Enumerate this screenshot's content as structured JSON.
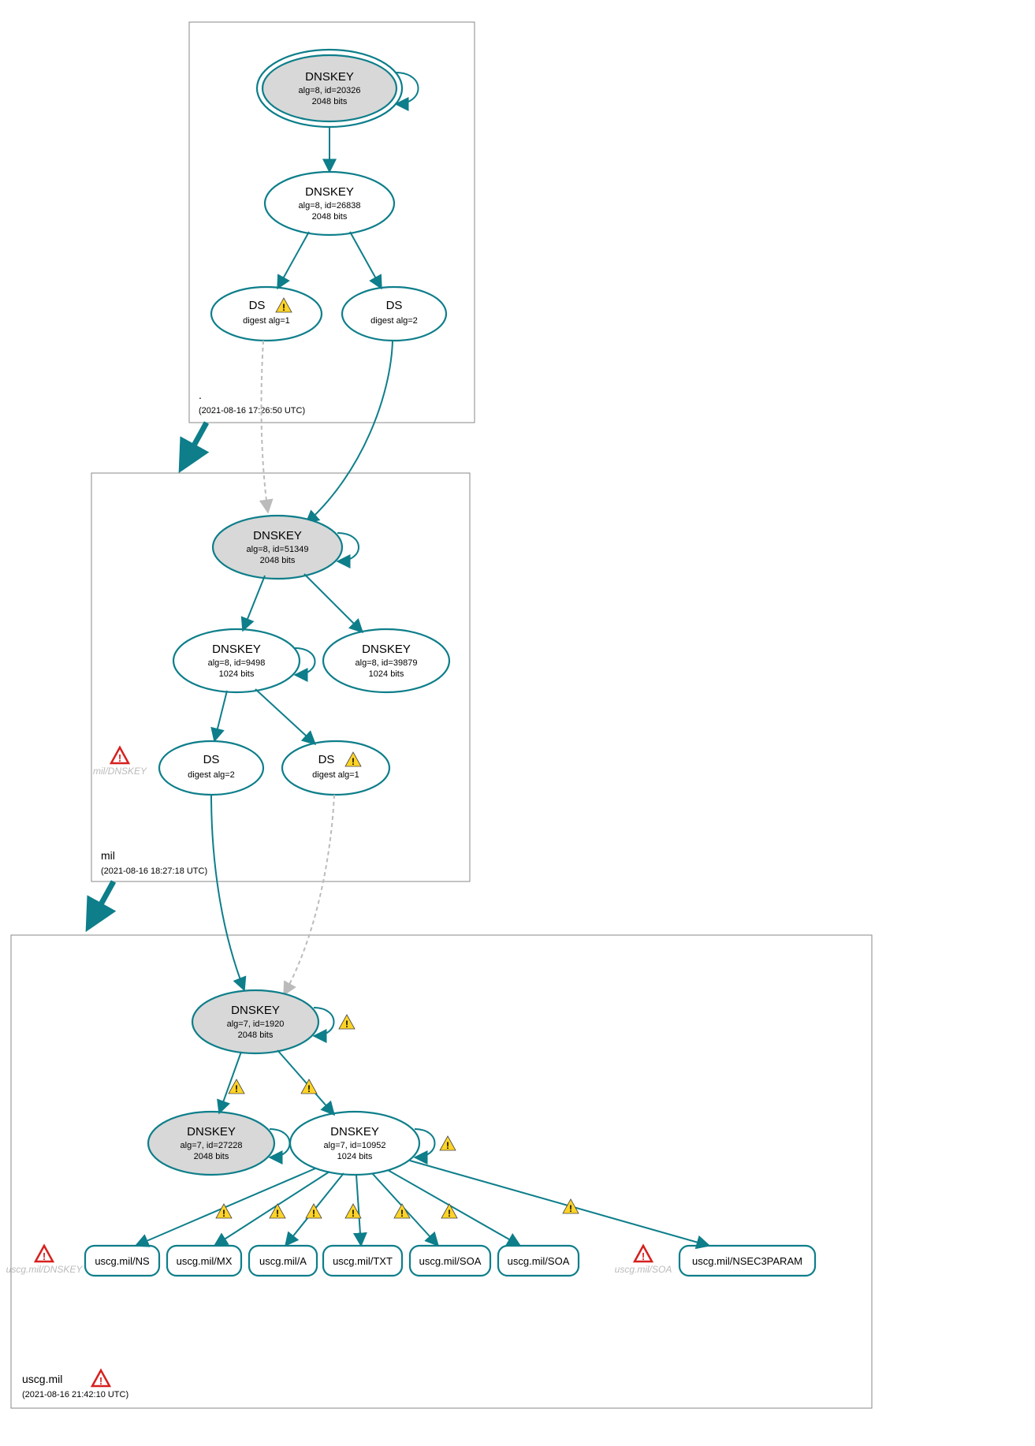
{
  "diagram_type": "DNSSEC authentication graph",
  "zones": {
    "root": {
      "name": ".",
      "timestamp": "(2021-08-16 17:26:50 UTC)",
      "nodes": {
        "ksk": {
          "title": "DNSKEY",
          "line1": "alg=8, id=20326",
          "line2": "2048 bits"
        },
        "zsk": {
          "title": "DNSKEY",
          "line1": "alg=8, id=26838",
          "line2": "2048 bits"
        },
        "ds1": {
          "title": "DS",
          "line1": "digest alg=1"
        },
        "ds2": {
          "title": "DS",
          "line1": "digest alg=2"
        }
      }
    },
    "mil": {
      "name": "mil",
      "timestamp": "(2021-08-16 18:27:18 UTC)",
      "side_label": "mil/DNSKEY",
      "nodes": {
        "ksk": {
          "title": "DNSKEY",
          "line1": "alg=8, id=51349",
          "line2": "2048 bits"
        },
        "zsk1": {
          "title": "DNSKEY",
          "line1": "alg=8, id=9498",
          "line2": "1024 bits"
        },
        "zsk2": {
          "title": "DNSKEY",
          "line1": "alg=8, id=39879",
          "line2": "1024 bits"
        },
        "ds2": {
          "title": "DS",
          "line1": "digest alg=2"
        },
        "ds1": {
          "title": "DS",
          "line1": "digest alg=1"
        }
      }
    },
    "uscg": {
      "name": "uscg.mil",
      "timestamp": "(2021-08-16 21:42:10 UTC)",
      "side_label_dnskey": "uscg.mil/DNSKEY",
      "side_label_soa": "uscg.mil/SOA",
      "nodes": {
        "ksk": {
          "title": "DNSKEY",
          "line1": "alg=7, id=1920",
          "line2": "2048 bits"
        },
        "zsk1": {
          "title": "DNSKEY",
          "line1": "alg=7, id=27228",
          "line2": "2048 bits"
        },
        "zsk2": {
          "title": "DNSKEY",
          "line1": "alg=7, id=10952",
          "line2": "1024 bits"
        }
      },
      "rrsets": {
        "ns": "uscg.mil/NS",
        "mx": "uscg.mil/MX",
        "a": "uscg.mil/A",
        "txt": "uscg.mil/TXT",
        "soa1": "uscg.mil/SOA",
        "soa2": "uscg.mil/SOA",
        "nsec": "uscg.mil/NSEC3PARAM"
      }
    }
  },
  "icons": {
    "warn_yellow": "⚠",
    "warn_red": "⚠"
  }
}
